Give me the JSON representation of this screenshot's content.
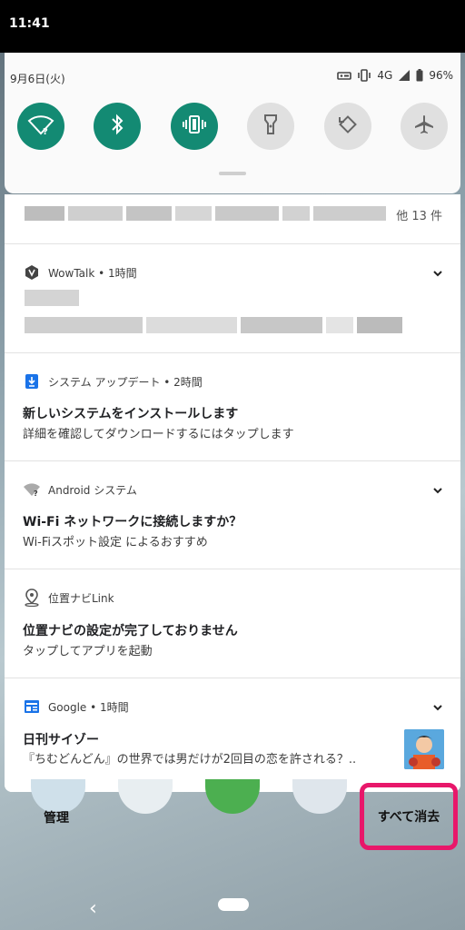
{
  "status_bar": {
    "time": "11:41"
  },
  "quick_settings": {
    "date": "9月6日(火)",
    "network": "4G",
    "battery": "96%",
    "tiles": [
      {
        "name": "wifi",
        "icon": "wifi-question-icon",
        "active": true
      },
      {
        "name": "bluetooth",
        "icon": "bluetooth-icon",
        "active": true
      },
      {
        "name": "vibrate",
        "icon": "vibrate-icon",
        "active": true
      },
      {
        "name": "flashlight",
        "icon": "flashlight-icon",
        "active": false
      },
      {
        "name": "auto-rotate",
        "icon": "rotate-icon",
        "active": false
      },
      {
        "name": "airplane",
        "icon": "airplane-icon",
        "active": false
      }
    ]
  },
  "notifications": {
    "collapsed": {
      "more_count": "他 13 件"
    },
    "wowtalk": {
      "header": "WowTalk • 1時間"
    },
    "system_update": {
      "header": "システム アップデート • 2時間",
      "title": "新しいシステムをインストールします",
      "body": "詳細を確認してダウンロードするにはタップします"
    },
    "android_system": {
      "header": "Android システム",
      "title": "Wi-Fi ネットワークに接続しますか？",
      "body": "Wi-Fiスポット設定 によるおすすめ"
    },
    "navi_link": {
      "header": "位置ナビLink",
      "title": "位置ナビの設定が完了しておりません",
      "body": "タップしてアプリを起動"
    },
    "google": {
      "header": "Google • 1時間",
      "title": "日刊サイゾー",
      "body": "『ちむどんどん』の世界では男だけが2回目の恋を許される？.."
    }
  },
  "actions": {
    "manage": "管理",
    "clear_all": "すべて消去"
  },
  "nav": {
    "back": "‹"
  },
  "colors": {
    "tile_active": "#138a73",
    "tile_inactive": "#e0e0e0",
    "highlight": "#e8176a"
  }
}
